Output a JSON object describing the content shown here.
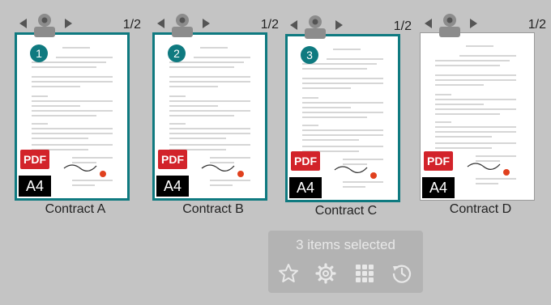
{
  "cards": [
    {
      "name": "Contract A",
      "page": "1/2",
      "badge": "1",
      "selected": true
    },
    {
      "name": "Contract B",
      "page": "1/2",
      "badge": "2",
      "selected": true
    },
    {
      "name": "Contract C",
      "page": "1/2",
      "badge": "3",
      "selected": true
    },
    {
      "name": "Contract D",
      "page": "1/2",
      "badge": "",
      "selected": false
    }
  ],
  "file_type": "PDF",
  "paper_size": "A4",
  "selection": {
    "text": "3 items selected",
    "actions": [
      "star-icon",
      "gear-icon",
      "grid-icon",
      "history-icon"
    ]
  },
  "colors": {
    "accent": "#0f7a80",
    "pdf_red": "#d2232a"
  }
}
